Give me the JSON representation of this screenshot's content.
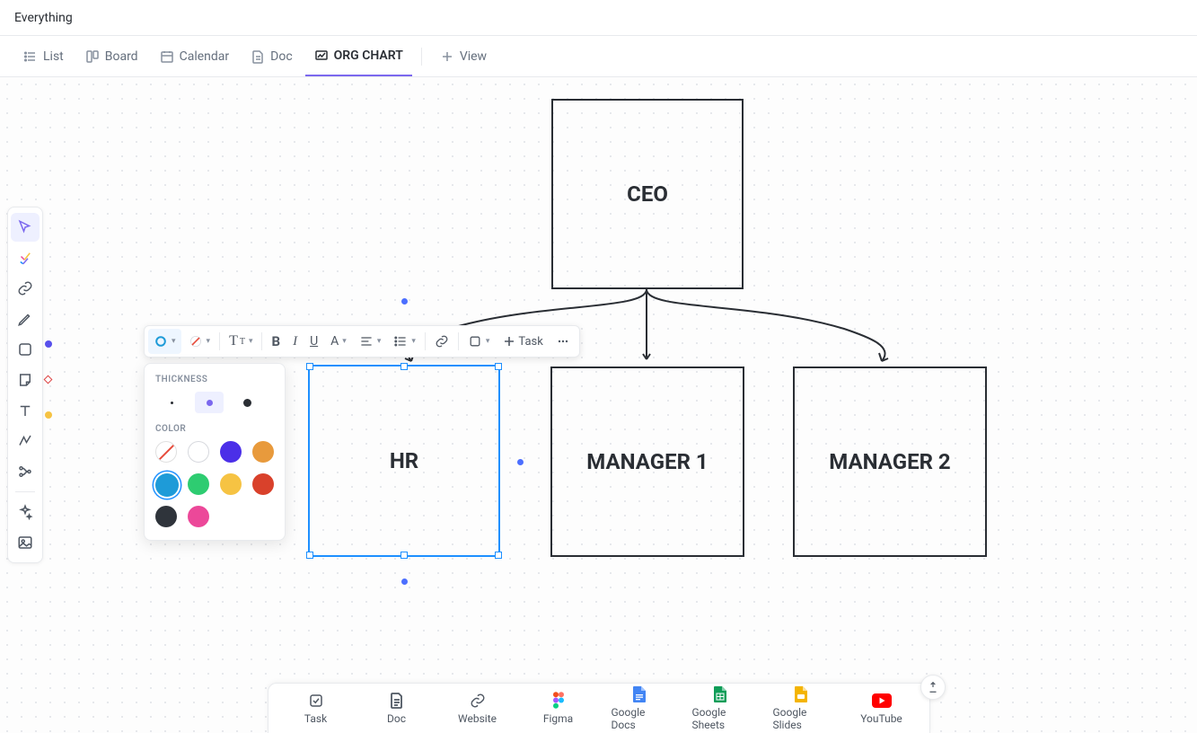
{
  "header": {
    "title": "Everything"
  },
  "tabs": {
    "list": "List",
    "board": "Board",
    "calendar": "Calendar",
    "doc": "Doc",
    "orgchart": "ORG CHART",
    "add_view": "View"
  },
  "nodes": {
    "ceo": "CEO",
    "hr": "HR",
    "manager1": "MANAGER 1",
    "manager2": "MANAGER 2"
  },
  "toolbox": {
    "select": "select-tool",
    "task": "task-tool",
    "link": "link-tool",
    "pen": "pen-tool",
    "shape": "shape-tool",
    "sticky": "sticky-tool",
    "text": "text-tool",
    "connector": "connector-tool",
    "mindmap": "mindmap-tool",
    "ai": "ai-tool",
    "image": "image-tool"
  },
  "fmt": {
    "task_label": "Task"
  },
  "popover": {
    "thickness": "THICKNESS",
    "color": "COLOR",
    "colors": {
      "none": "none",
      "white": "#ffffff",
      "indigo": "#4b2fe8",
      "orange": "#e89a3c",
      "blue": "#1e9bd8",
      "green": "#2ecc71",
      "yellow": "#f6c343",
      "red": "#d9412b",
      "charcoal": "#2f343b",
      "pink": "#ec4899"
    },
    "selected_color": "blue",
    "selected_thickness": "medium"
  },
  "dock": {
    "task": "Task",
    "doc": "Doc",
    "website": "Website",
    "figma": "Figma",
    "gdocs": "Google Docs",
    "gsheets": "Google Sheets",
    "gslides": "Google Slides",
    "youtube": "YouTube"
  }
}
